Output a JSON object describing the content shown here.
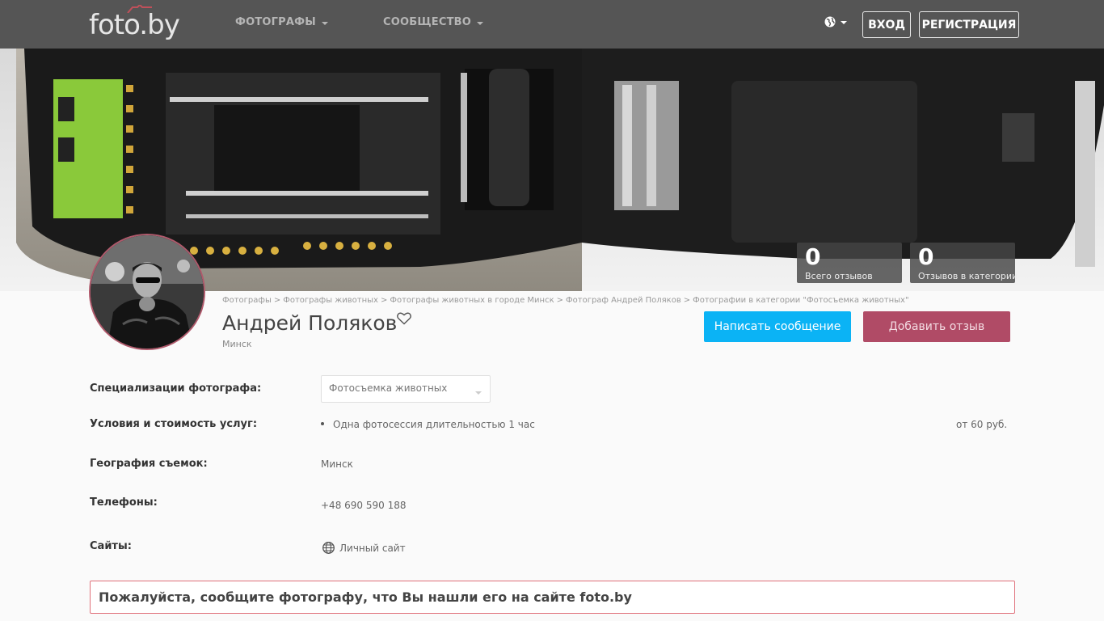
{
  "header": {
    "logo_text": "foto.by",
    "nav": [
      {
        "label": "ФОТОГРАФЫ"
      },
      {
        "label": "СООБЩЕСТВО"
      }
    ],
    "login_label": "ВХОД",
    "register_label": "РЕГИСТРАЦИЯ"
  },
  "stats": [
    {
      "value": "0",
      "label": "Всего отзывов"
    },
    {
      "value": "0",
      "label": "Отзывов в категории"
    }
  ],
  "breadcrumb": [
    "Фотографы",
    "Фотографы животных",
    "Фотографы животных в городе Минск",
    "Фотограф Андрей Поляков",
    "Фотографии в категории \"Фотосъемка животных\""
  ],
  "breadcrumb_separator": ">",
  "profile": {
    "name": "Андрей Поляков",
    "city": "Минск",
    "message_button": "Написать сообщение",
    "review_button": "Добавить отзыв"
  },
  "details": {
    "specializations_label": "Специализации фотографа:",
    "specialization_selected": "Фотосъемка животных",
    "conditions_label": "Условия и стоимость услуг:",
    "service_name": "Одна фотосессия длительностью 1 час",
    "service_price": "от 60 руб.",
    "geography_label": "География съемок:",
    "geography_value": "Минск",
    "phones_label": "Телефоны:",
    "phone_value": "+48 690 590 188",
    "sites_label": "Сайты:",
    "site_value": "Личный сайт"
  },
  "notice": "Пожалуйста, сообщите фотографу, что Вы нашли его на сайте foto.by",
  "colors": {
    "header_bg": "#555555",
    "message_button": "#0bb3f5",
    "review_button": "#b04b66",
    "notice_border": "#e0707a"
  }
}
